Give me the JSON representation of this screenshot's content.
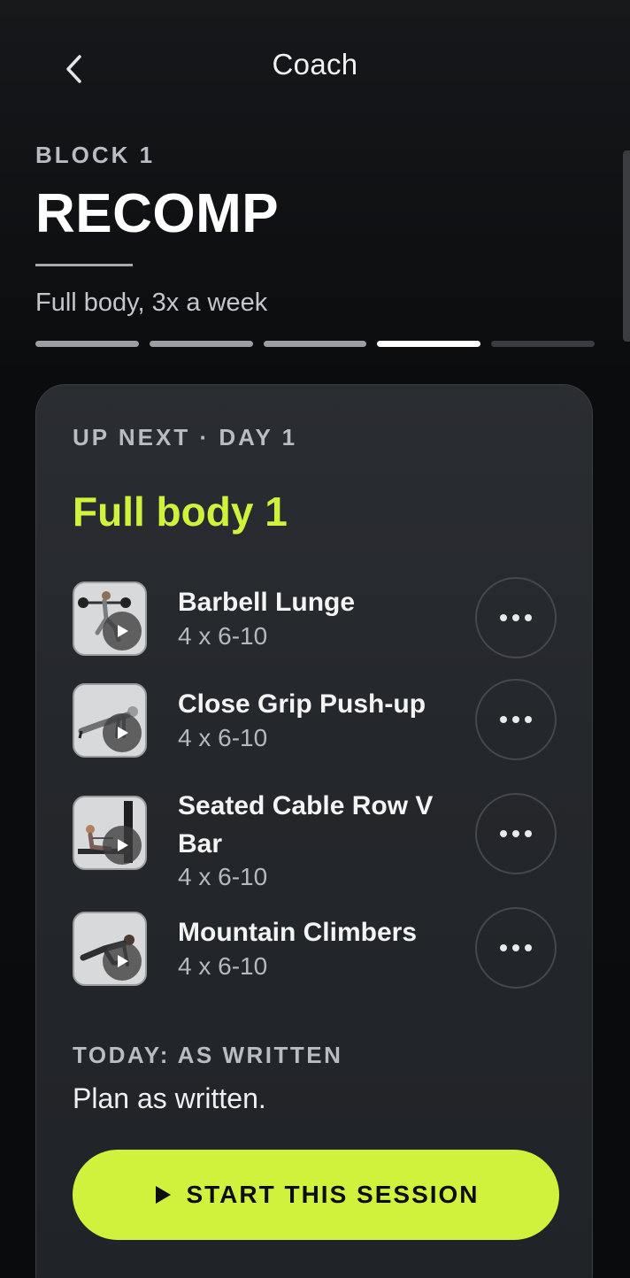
{
  "header": {
    "title": "Coach",
    "back_icon": "chevron-left-icon"
  },
  "block": {
    "label": "BLOCK 1",
    "title": "RECOMP",
    "subtitle": "Full body, 3x a week",
    "progress": {
      "segments": 5,
      "completed": 3,
      "current": 4
    }
  },
  "card": {
    "upnext": "UP NEXT · DAY 1",
    "day_title": "Full body 1",
    "exercises": [
      {
        "name": "Barbell Lunge",
        "sets": "4 x 6-10",
        "thumb_icon": "barbell-lunge-thumbnail"
      },
      {
        "name": "Close Grip Push-up",
        "sets": "4 x 6-10",
        "thumb_icon": "push-up-thumbnail"
      },
      {
        "name": "Seated Cable Row V Bar",
        "sets": "4 x 6-10",
        "thumb_icon": "cable-row-thumbnail"
      },
      {
        "name": "Mountain Climbers",
        "sets": "4 x 6-10",
        "thumb_icon": "mountain-climbers-thumbnail"
      }
    ],
    "today_label": "TODAY: AS WRITTEN",
    "today_text": "Plan as written.",
    "start_label": "START THIS SESSION"
  },
  "colors": {
    "accent": "#d1f23c",
    "background": "#0d0e10",
    "card": "#25282c"
  }
}
